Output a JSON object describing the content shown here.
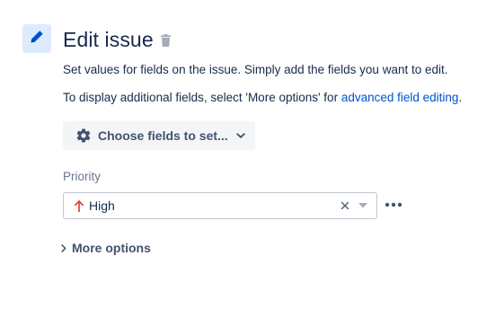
{
  "header": {
    "title": "Edit issue",
    "icon": "pencil-icon",
    "delete_icon": "trash-icon",
    "accent_color": "#0052cc",
    "tile_color": "#deebff"
  },
  "description": {
    "line1": "Set values for fields on the issue. Simply add the fields you want to edit.",
    "line2_prefix": "To display additional fields, select 'More options' for ",
    "line2_link": "advanced field editing",
    "line2_suffix": "."
  },
  "choose_fields": {
    "label": "Choose fields to set...",
    "icon": "gear-icon",
    "chevron": "chevron-down-icon"
  },
  "priority": {
    "label": "Priority",
    "value": "High",
    "value_icon": "arrow-up-icon",
    "value_color": "#e5493a",
    "clear_icon": "clear-icon",
    "dropdown_icon": "caret-down-icon",
    "more_icon": "more-icon"
  },
  "more_options": {
    "label": "More options",
    "icon": "chevron-right-icon"
  }
}
